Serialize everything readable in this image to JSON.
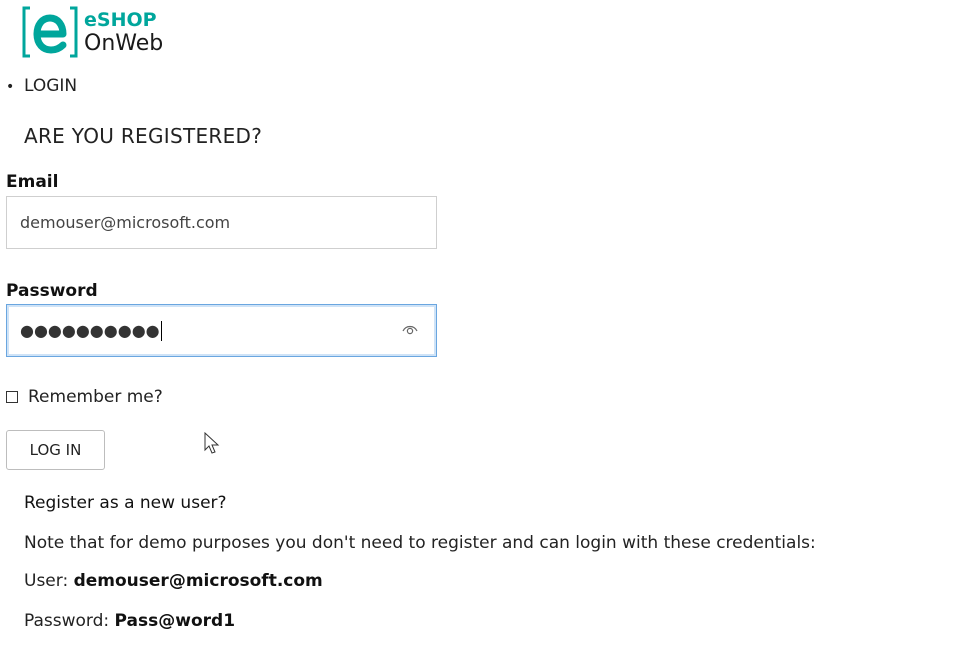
{
  "logo": {
    "line1": "eSHOP",
    "line2": "OnWeb",
    "accent_color": "#00a69c"
  },
  "breadcrumb": {
    "bullet": "•",
    "label": "LOGIN"
  },
  "section_title": "ARE YOU REGISTERED?",
  "form": {
    "email_label": "Email",
    "email_value": "demouser@microsoft.com",
    "password_label": "Password",
    "password_masked": "●●●●●●●●●●",
    "password_toggle_icon": "eye-icon",
    "remember_label": "Remember me?",
    "remember_checked": false,
    "login_button": "LOG IN"
  },
  "register_link": "Register as a new user?",
  "notes": {
    "demo_note": "Note that for demo purposes you don't need to register and can login with these credentials:",
    "user_prefix": "User: ",
    "user_value": "demouser@microsoft.com",
    "password_prefix": "Password: ",
    "password_value": "Pass@word1"
  }
}
